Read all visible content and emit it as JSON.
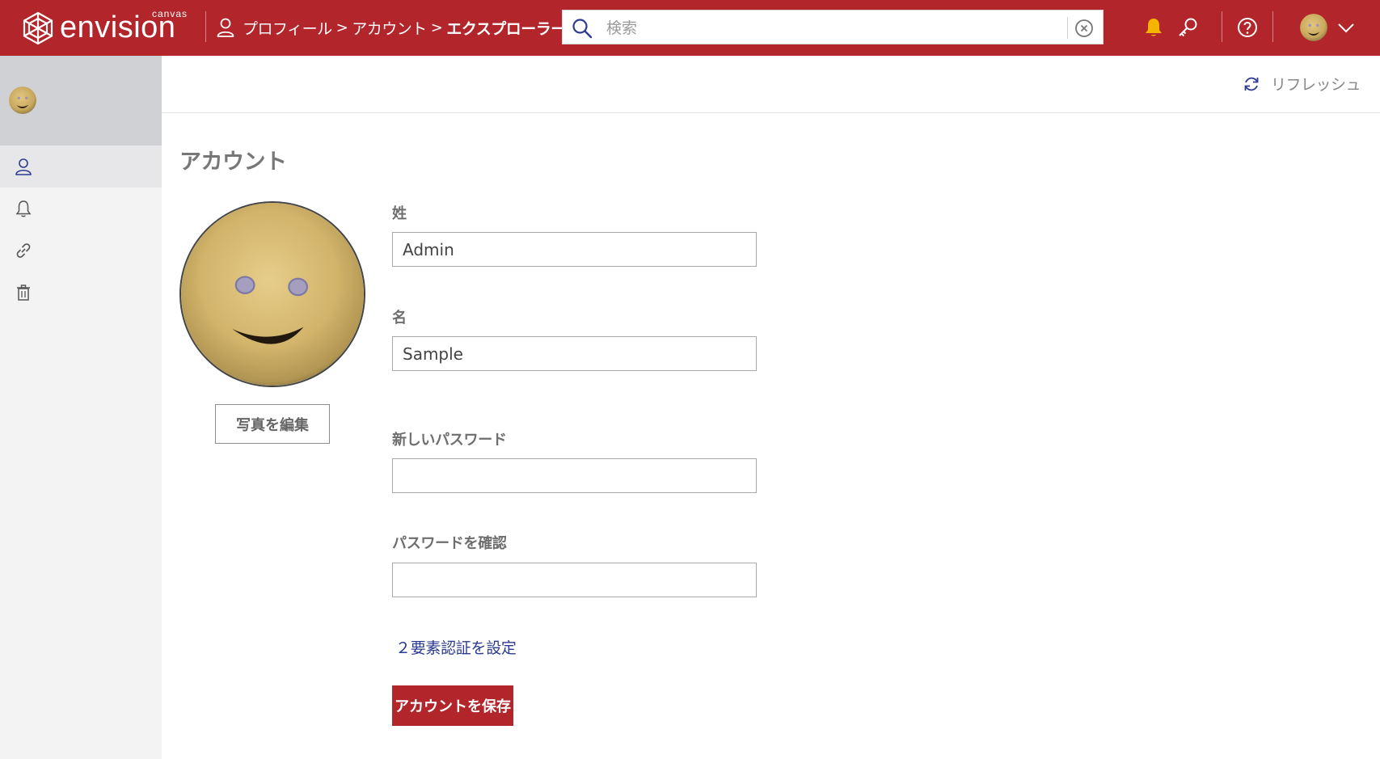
{
  "app": {
    "brand": "envision",
    "brand_sub": "canvas",
    "brand_color": "#b1252b"
  },
  "breadcrumb": {
    "items": [
      "プロフィール",
      "アカウント",
      "エクスプローラー"
    ],
    "separator": ">"
  },
  "search": {
    "placeholder": "検索",
    "value": ""
  },
  "header_icons": [
    "bell-icon",
    "key-icon",
    "help-icon",
    "user-avatar",
    "chevron-down-icon"
  ],
  "sidebar": {
    "items": [
      {
        "icon": "user-icon",
        "active": true
      },
      {
        "icon": "bell-icon",
        "active": false
      },
      {
        "icon": "link-icon",
        "active": false
      },
      {
        "icon": "trash-icon",
        "active": false
      }
    ]
  },
  "toolbar": {
    "refresh_label": "リフレッシュ"
  },
  "account": {
    "title": "アカウント",
    "edit_photo_label": "写真を編集",
    "fields": {
      "last_name": {
        "label": "姓",
        "value": "Admin"
      },
      "first_name": {
        "label": "名",
        "value": "Sample"
      },
      "new_password": {
        "label": "新しいパスワード",
        "value": ""
      },
      "confirm_password": {
        "label": "パスワードを確認",
        "value": ""
      }
    },
    "two_factor_link": "２要素認証を設定",
    "save_label": "アカウントを保存"
  }
}
